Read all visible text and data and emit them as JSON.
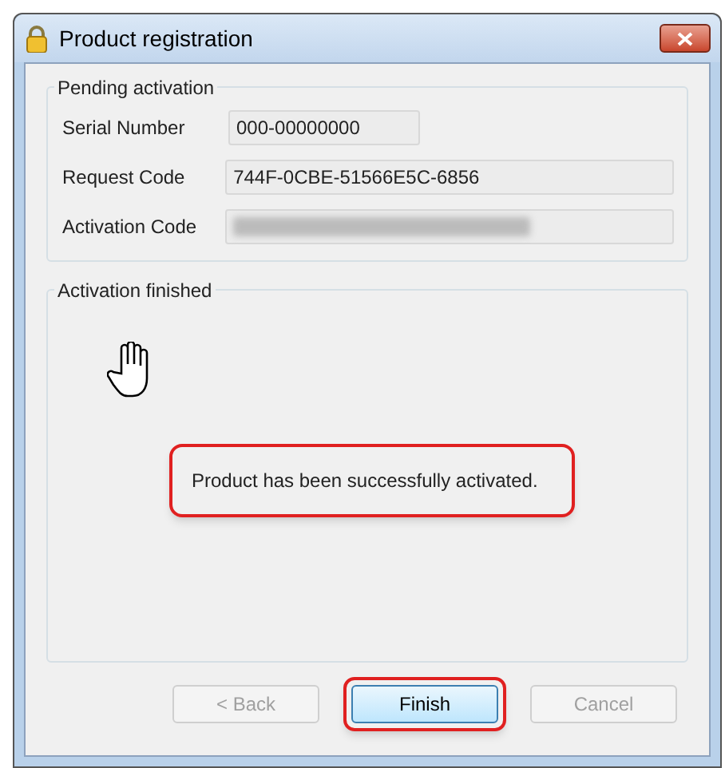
{
  "window": {
    "title": "Product registration"
  },
  "pending_group": {
    "title": "Pending activation",
    "fields": [
      {
        "label": "Serial Number",
        "value": "000-00000000",
        "kind": "short"
      },
      {
        "label": "Request Code",
        "value": "744F-0CBE-51566E5C-6856",
        "kind": "wide"
      },
      {
        "label": "Activation Code",
        "kind": "blurred"
      }
    ]
  },
  "finished_group": {
    "title": "Activation finished",
    "message": "Product has been successfully activated.",
    "message_highlighted": true
  },
  "buttons": [
    {
      "label": "< Back",
      "disabled": true,
      "highlighted": false
    },
    {
      "label": "Finish",
      "disabled": false,
      "highlighted": true
    },
    {
      "label": "Cancel",
      "disabled": true,
      "highlighted": false
    }
  ]
}
